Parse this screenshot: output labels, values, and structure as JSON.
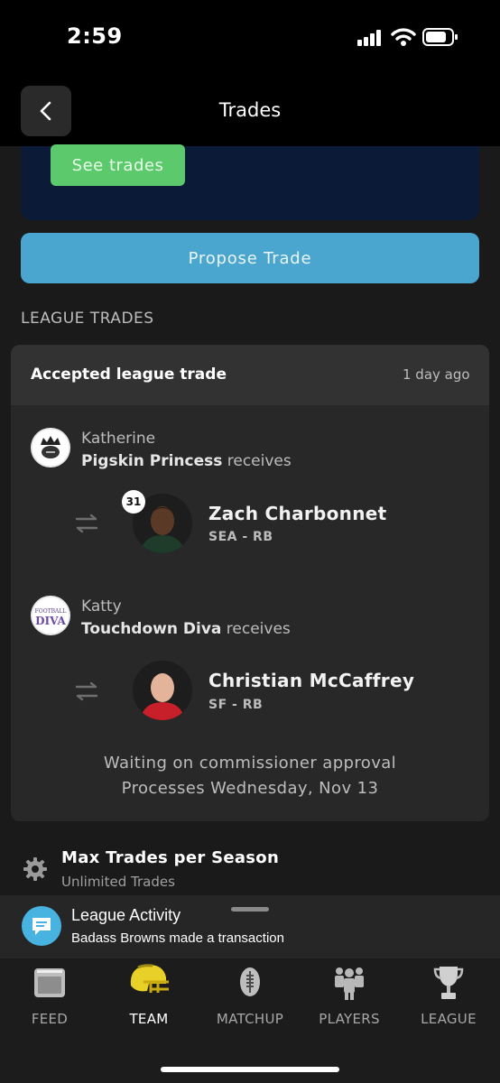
{
  "status_bar": {
    "time": "2:59"
  },
  "header": {
    "title": "Trades"
  },
  "banner": {
    "see_trades_label": "See trades"
  },
  "propose_label": "Propose Trade",
  "section_title": "LEAGUE TRADES",
  "trade_card": {
    "title": "Accepted league trade",
    "time": "1 day ago",
    "sides": [
      {
        "owner": "Katherine",
        "team": "Pigskin Princess",
        "receives": " receives",
        "player": {
          "name": "Zach Charbonnet",
          "pos": "SEA - RB",
          "badge": "31"
        }
      },
      {
        "owner": "Katty",
        "team": "Touchdown Diva",
        "receives": " receives",
        "player": {
          "name": "Christian McCaffrey",
          "pos": "SF - RB"
        }
      }
    ],
    "status_line1": "Waiting on commissioner approval",
    "status_line2": "Processes Wednesday, Nov 13"
  },
  "setting": {
    "title": "Max Trades per Season",
    "value": "Unlimited Trades"
  },
  "activity": {
    "title": "League Activity",
    "text": "Badass Browns made a transaction"
  },
  "tabs": [
    {
      "label": "FEED",
      "icon": "feed-icon",
      "active": false
    },
    {
      "label": "TEAM",
      "icon": "helmet-icon",
      "active": true
    },
    {
      "label": "MATCHUP",
      "icon": "football-icon",
      "active": false
    },
    {
      "label": "PLAYERS",
      "icon": "players-icon",
      "active": false
    },
    {
      "label": "LEAGUE",
      "icon": "trophy-icon",
      "active": false
    }
  ],
  "colors": {
    "propose": "#4ba6cf",
    "see_trades": "#5cc96d",
    "banner": "#0b1a37",
    "activity_icon": "#48b3e0"
  }
}
